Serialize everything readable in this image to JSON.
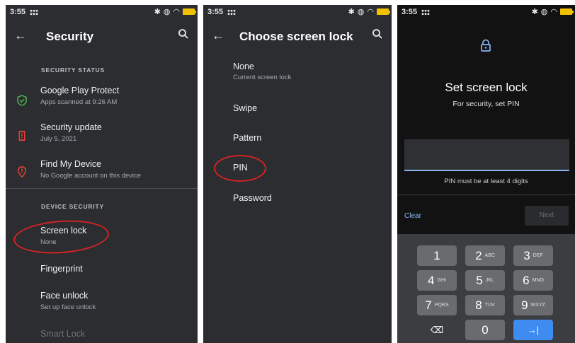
{
  "panel1": {
    "status_time": "3:55",
    "back_icon": "arrow-left-icon",
    "title": "Security",
    "search_icon": "search-icon",
    "section_status": "SECURITY STATUS",
    "items": [
      {
        "title": "Google Play Protect",
        "sub": "Apps scanned at 9:26 AM",
        "icon": "shield-check-icon",
        "color": "#4caf50"
      },
      {
        "title": "Security update",
        "sub": "July 5, 2021",
        "icon": "phone-alert-icon",
        "color": "#f44336"
      },
      {
        "title": "Find My Device",
        "sub": "No Google account on this device",
        "icon": "location-alert-icon",
        "color": "#f44336"
      }
    ],
    "section_device": "DEVICE SECURITY",
    "device_items": [
      {
        "title": "Screen lock",
        "sub": "None"
      },
      {
        "title": "Fingerprint",
        "sub": ""
      },
      {
        "title": "Face unlock",
        "sub": "Set up face unlock"
      },
      {
        "title": "Smart Lock",
        "sub": ""
      }
    ]
  },
  "panel2": {
    "status_time": "3:55",
    "title": "Choose screen lock",
    "options": [
      {
        "title": "None",
        "sub": "Current screen lock"
      },
      {
        "title": "Swipe",
        "sub": ""
      },
      {
        "title": "Pattern",
        "sub": ""
      },
      {
        "title": "PIN",
        "sub": ""
      },
      {
        "title": "Password",
        "sub": ""
      }
    ]
  },
  "panel3": {
    "status_time": "3:55",
    "title": "Set screen lock",
    "subtitle": "For security, set PIN",
    "hint": "PIN must be at least 4 digits",
    "clear_label": "Clear",
    "next_label": "Next",
    "keys": [
      {
        "num": "1",
        "letters": ""
      },
      {
        "num": "2",
        "letters": "ABC"
      },
      {
        "num": "3",
        "letters": "DEF"
      },
      {
        "num": "4",
        "letters": "GHI"
      },
      {
        "num": "5",
        "letters": "JKL"
      },
      {
        "num": "6",
        "letters": "MNO"
      },
      {
        "num": "7",
        "letters": "PQRS"
      },
      {
        "num": "8",
        "letters": "TUV"
      },
      {
        "num": "9",
        "letters": "WXYZ"
      },
      {
        "num": "⌫",
        "letters": ""
      },
      {
        "num": "0",
        "letters": ""
      },
      {
        "num": "→|",
        "letters": ""
      }
    ]
  },
  "colors": {
    "panel_bg": "#2b2d30",
    "pin_bg": "#121212",
    "accent_blue": "#8ab4f8",
    "enter_key": "#3f8cf0",
    "annotation_red": "#d42424"
  }
}
